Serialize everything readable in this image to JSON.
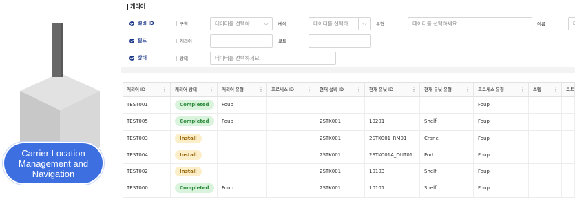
{
  "illustration": {
    "caption_lines": [
      "Carrier Location",
      "Management and",
      "Navigation"
    ]
  },
  "panel": {
    "title": "캐리어"
  },
  "filters": {
    "equipment_id": {
      "label": "설비 ID",
      "zone_label": "구역",
      "zone_value": "데이터를 선택하...",
      "bay_label": "베이",
      "bay_value": "데이터를 선택하...",
      "type_label": "유형",
      "type_placeholder": "데이터를 선택하세요.",
      "name_label": "이름",
      "name_value": "데"
    },
    "field": {
      "label": "필드",
      "carrier_label": "캐리어",
      "carrier_value": "",
      "lot_label": "로트",
      "lot_value": ""
    },
    "status": {
      "label": "상태",
      "status_label": "상태",
      "status_placeholder": "데이터를 선택하세요."
    }
  },
  "table": {
    "columns": [
      "캐리어 ID",
      "캐리어 상태",
      "캐리어 유형",
      "프로세스 ID",
      "현재 설비 ID",
      "현재 유닛 ID",
      "현재 유닛 유형",
      "프로세스 유형",
      "스텝",
      "로트"
    ],
    "rows": [
      {
        "id": "TEST001",
        "status": "Completed",
        "type": "Foup",
        "process_id": "",
        "equip": "",
        "unit": "",
        "unit_type": "",
        "proc_type": "Foup",
        "step": "",
        "lot": ""
      },
      {
        "id": "TEST005",
        "status": "Completed",
        "type": "Foup",
        "process_id": "",
        "equip": "2STK001",
        "unit": "10201",
        "unit_type": "Shelf",
        "proc_type": "Foup",
        "step": "",
        "lot": ""
      },
      {
        "id": "TEST003",
        "status": "Install",
        "type": "",
        "process_id": "",
        "equip": "2STK001",
        "unit": "2STK001_RM01",
        "unit_type": "Crane",
        "proc_type": "Foup",
        "step": "",
        "lot": ""
      },
      {
        "id": "TEST004",
        "status": "Install",
        "type": "",
        "process_id": "",
        "equip": "2STK001",
        "unit": "2STK001A_OUT01",
        "unit_type": "Port",
        "proc_type": "Foup",
        "step": "",
        "lot": ""
      },
      {
        "id": "TEST002",
        "status": "Install",
        "type": "",
        "process_id": "",
        "equip": "2STK001",
        "unit": "10103",
        "unit_type": "Shelf",
        "proc_type": "Foup",
        "step": "",
        "lot": ""
      },
      {
        "id": "TEST000",
        "status": "Completed",
        "type": "Foup",
        "process_id": "",
        "equip": "2STK001",
        "unit": "10101",
        "unit_type": "Shelf",
        "proc_type": "Foup",
        "step": "",
        "lot": ""
      }
    ]
  },
  "colors": {
    "accent": "#3d6fe0",
    "label_blue": "#1f3a8a",
    "completed_bg": "#d9f3dc",
    "completed_fg": "#2e8b3d",
    "install_bg": "#fbeec8",
    "install_fg": "#9a6a10"
  },
  "icons": {
    "filter_bullet": "check-circle-icon",
    "dropdown": "chevron-down-icon",
    "column_menu": "kebab-menu-icon"
  }
}
